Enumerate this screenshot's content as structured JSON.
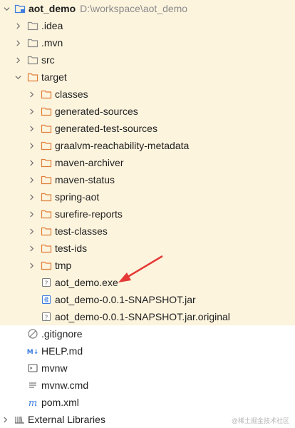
{
  "project": {
    "name": "aot_demo",
    "path": "D:\\workspace\\aot_demo"
  },
  "rows": [
    {
      "label": ".idea"
    },
    {
      "label": ".mvn"
    },
    {
      "label": "src"
    },
    {
      "label": "target"
    },
    {
      "label": "classes"
    },
    {
      "label": "generated-sources"
    },
    {
      "label": "generated-test-sources"
    },
    {
      "label": "graalvm-reachability-metadata"
    },
    {
      "label": "maven-archiver"
    },
    {
      "label": "maven-status"
    },
    {
      "label": "spring-aot"
    },
    {
      "label": "surefire-reports"
    },
    {
      "label": "test-classes"
    },
    {
      "label": "test-ids"
    },
    {
      "label": "tmp"
    },
    {
      "label": "aot_demo.exe"
    },
    {
      "label": "aot_demo-0.0.1-SNAPSHOT.jar"
    },
    {
      "label": "aot_demo-0.0.1-SNAPSHOT.jar.original"
    },
    {
      "label": ".gitignore"
    },
    {
      "label": "HELP.md"
    },
    {
      "label": "mvnw"
    },
    {
      "label": "mvnw.cmd"
    },
    {
      "label": "pom.xml"
    },
    {
      "label": "External Libraries"
    }
  ],
  "icons": {
    "md_badge": "M↓",
    "unknown_badge": "?",
    "maven_badge": "m"
  },
  "colors": {
    "folder": "#8a8a8a",
    "target_folder": "#e07e3a",
    "arrow": "#e53935",
    "highlight": "#fdf4de"
  },
  "watermark": "@稀土掘金技术社区"
}
